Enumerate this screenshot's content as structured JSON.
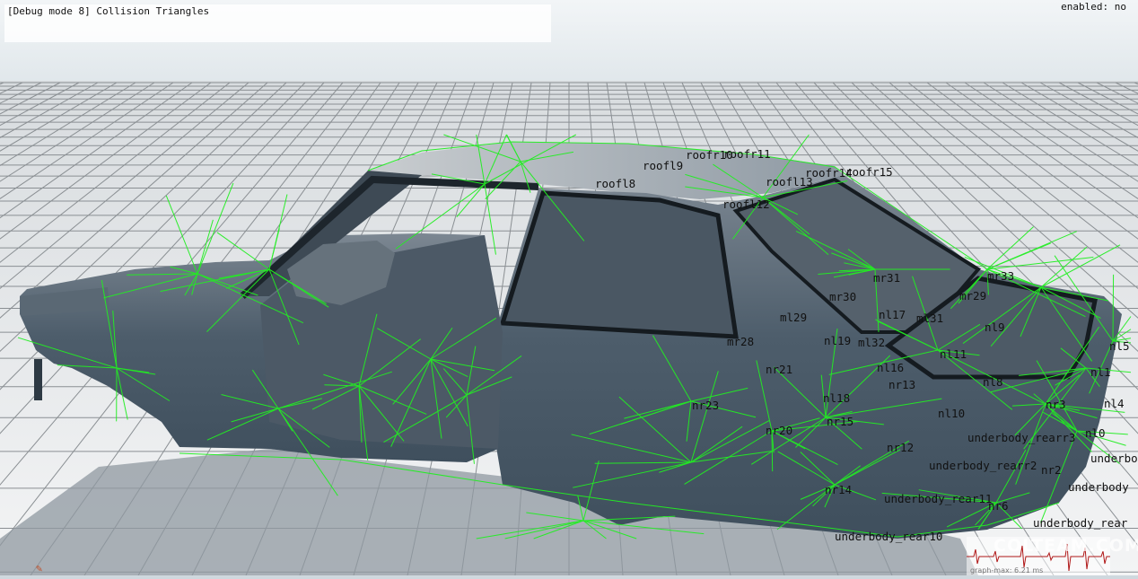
{
  "debug": {
    "title": "[Debug mode 8] Collision Triangles",
    "enabled_status": "enabled: no"
  },
  "colors": {
    "sky": "#e8eef2",
    "grid_line": "#8a8f93",
    "floor": "#e2e5e7",
    "body": "#4c5c6a",
    "collision_wire": "#22ee22"
  },
  "icons": {
    "corner": "tool-icon"
  },
  "node_labels": [
    "roofr10",
    "roofr11",
    "roofl9",
    "roofl8",
    "roofr14",
    "roofr15",
    "roofl13",
    "roofl12",
    "mr33",
    "mr31",
    "mr30",
    "mr29",
    "ml29",
    "nl17",
    "ml31",
    "nl9",
    "nl19",
    "ml32",
    "mr28",
    "nl11",
    "nl5",
    "nr21",
    "nl16",
    "nr13",
    "nl8",
    "nl1",
    "nl18",
    "nr23",
    "nr15",
    "nl10",
    "nl4",
    "nr3",
    "nr20",
    "underbody_rearr3",
    "nl0",
    "nr12",
    "underbody_rearr2",
    "nr2",
    "underbody",
    "underbody",
    "nr14",
    "underbody_rear11",
    "nr6",
    "underbody_rear",
    "underbody_rear10"
  ],
  "graph": {
    "max_label": "graph-max: 6.21 ms"
  },
  "watermark": "COLTEAM.COM"
}
